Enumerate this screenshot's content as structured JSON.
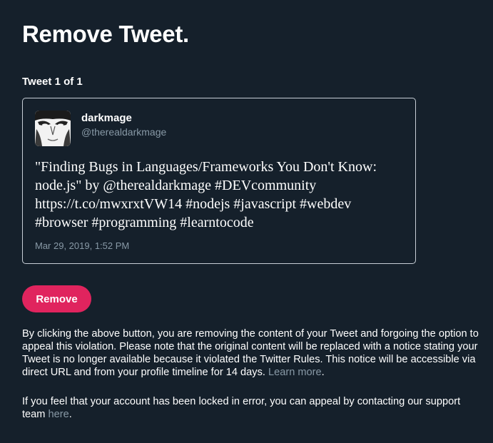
{
  "page": {
    "title": "Remove Tweet.",
    "tweet_counter": "Tweet 1 of 1"
  },
  "tweet": {
    "display_name": "darkmage",
    "handle": "@therealdarkmage",
    "text": "\"Finding Bugs in Languages/Frameworks You Don't Know: node.js\" by @therealdarkmage #DEVcommunity https://t.co/mwxrxtVW14 #nodejs #javascript #webdev #browser #programming #learntocode",
    "date": "Mar 29, 2019, 1:52 PM"
  },
  "actions": {
    "remove_label": "Remove"
  },
  "notice": {
    "text": "By clicking the above button, you are removing the content of your Tweet and forgoing the option to appeal this violation. Please note that the original content will be replaced with a notice stating your Tweet is no longer available because it violated the Twitter Rules. This notice will be accessible via direct URL and from your profile timeline for 14 days.",
    "learn_more_label": "Learn more",
    "trailing": "."
  },
  "appeal": {
    "text": "If you feel that your account has been locked in error, you can appeal by contacting our support team",
    "here_label": "here",
    "trailing": "."
  },
  "colors": {
    "background": "#15202b",
    "accent": "#e0245e",
    "muted_text": "#8899a6",
    "card_border": "#c7ced6"
  }
}
